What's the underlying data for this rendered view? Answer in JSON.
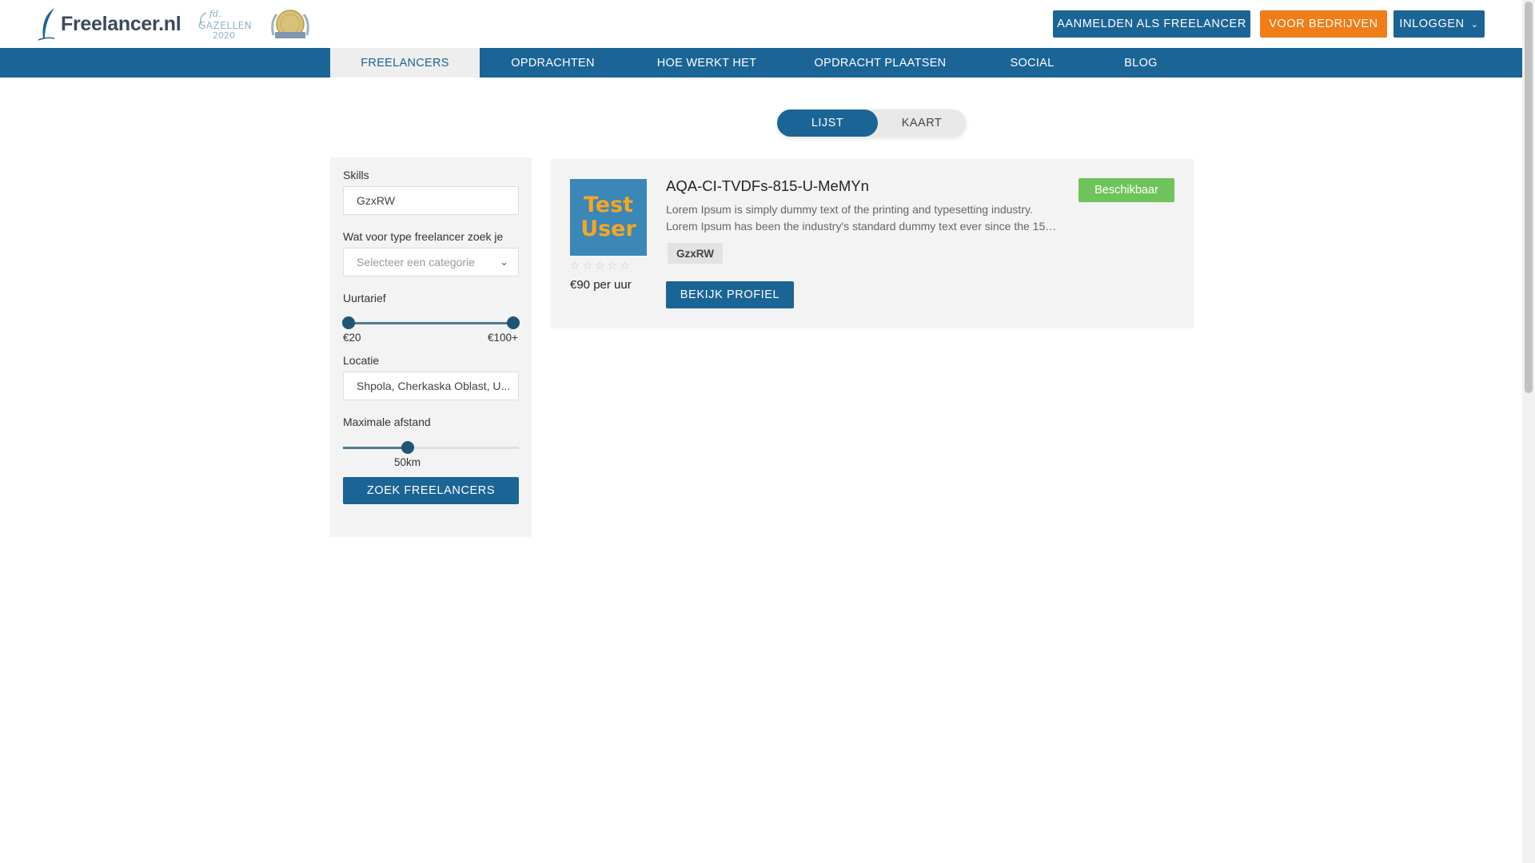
{
  "header": {
    "logo_text": "Freelancer.nl",
    "badge_gazellen": {
      "top": "fd.",
      "middle": "GAZELLEN",
      "bottom": "2020"
    },
    "btn_freelancer": "AANMELDEN ALS FREELANCER",
    "btn_bedrijven": "VOOR BEDRIJVEN",
    "btn_inloggen": "INLOGGEN"
  },
  "nav": {
    "items": [
      "FREELANCERS",
      "OPDRACHTEN",
      "HOE WERKT HET",
      "OPDRACHT PLAATSEN",
      "SOCIAL",
      "BLOG"
    ],
    "active_index": 0
  },
  "view_toggle": {
    "lijst": "LIJST",
    "kaart": "KAART",
    "selected": "LIJST"
  },
  "filters": {
    "skills_label": "Skills",
    "skills_value": "GzxRW",
    "type_label": "Wat voor type freelancer zoek je",
    "type_placeholder": "Selecteer een categorie",
    "rate_label": "Uurtarief",
    "rate_min": "€20",
    "rate_max": "€100+",
    "location_label": "Locatie",
    "location_value": "Shpola, Cherkaska Oblast, U...",
    "distance_label": "Maximale afstand",
    "distance_value": "50km",
    "distance_fraction": 0.37,
    "search_button": "ZOEK FREELANCERS"
  },
  "results": [
    {
      "avatar_line1": "Test",
      "avatar_line2": "User",
      "rating_stars": "☆☆☆☆☆",
      "rate": "€90 per uur",
      "name": "AQA-CI-TVDFs-815-U-MeMYn",
      "desc_line1": "Lorem Ipsum is simply dummy text of the printing and typesetting industry.",
      "desc_line2": "Lorem Ipsum has been the industry's standard dummy text ever since the 150...",
      "skill": "GzxRW",
      "profile_button": "BEKIJK PROFIEL",
      "status": "Beschikbaar"
    }
  ],
  "colors": {
    "primary": "#1b6496",
    "accent": "#f07d18",
    "available": "#6fc35b"
  }
}
